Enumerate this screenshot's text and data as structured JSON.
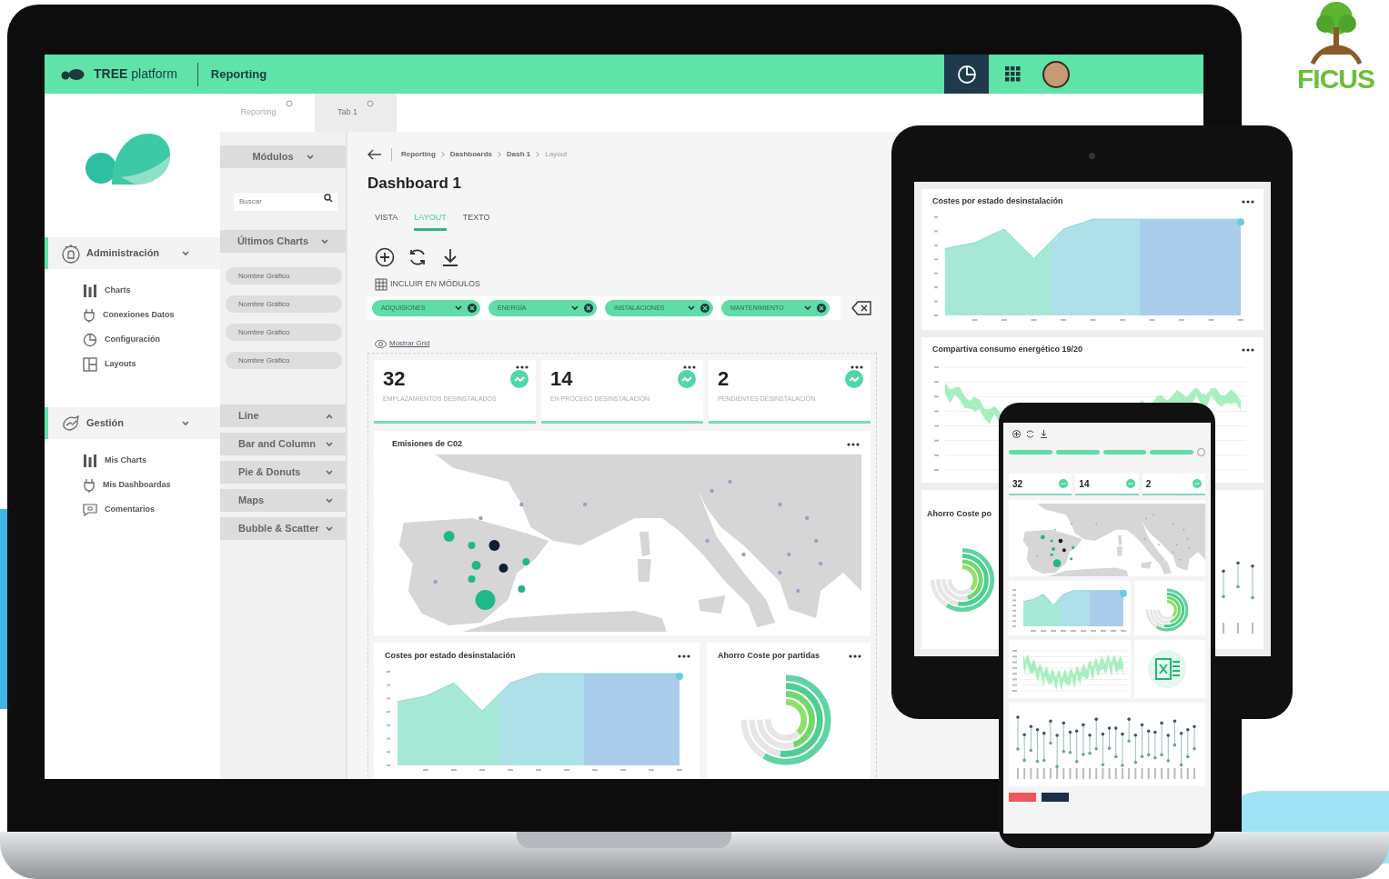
{
  "logo": {
    "text": "FICUS"
  },
  "header": {
    "brand": "**TREE** platform",
    "section": "Reporting"
  },
  "tabs": [
    {
      "label": "Reporting",
      "selected": false
    },
    {
      "label": "Tab 1",
      "selected": true
    }
  ],
  "sidebar": {
    "sections": [
      {
        "label": "Administración",
        "expanded": true,
        "items": [
          "Charts",
          "Conexiones Datos",
          "Configuración",
          "Layouts"
        ]
      },
      {
        "label": "Gestión",
        "expanded": true,
        "items": [
          "Mis Charts",
          "Mis Dashboardas",
          "Comentarios"
        ]
      }
    ]
  },
  "modules": {
    "title": "Módulos",
    "search": {
      "placeholder": "Buscar"
    },
    "recent_title": "Últimos Charts",
    "recent": [
      "Nombre Gráfico",
      "Nombre Gráfico",
      "Nombre Gráfico",
      "Nombre Gráfico"
    ],
    "groups": [
      {
        "label": "Line",
        "expanded": true
      },
      {
        "label": "Bar and Column",
        "expanded": false
      },
      {
        "label": "Pie & Donuts",
        "expanded": false
      },
      {
        "label": "Maps",
        "expanded": false
      },
      {
        "label": "Bubble & Scatter",
        "expanded": false
      }
    ]
  },
  "breadcrumb": [
    {
      "label": "Reporting",
      "current": false
    },
    {
      "label": "Dashboards",
      "current": false
    },
    {
      "label": "Dash 1",
      "current": false
    },
    {
      "label": "Layout",
      "current": true
    }
  ],
  "title": "Dashboard 1",
  "view_tabs": [
    {
      "label": "VISTA",
      "selected": false
    },
    {
      "label": "LAYOUT",
      "selected": true
    },
    {
      "label": "TEXTO",
      "selected": false
    }
  ],
  "include_label": "INCLUIR EN MÓDULOS",
  "chips": [
    "ADQUISIONES",
    "ENERGÍA",
    "INSTALACIONES",
    "MANTENIMIENTO"
  ],
  "grid_link": "Mostrar Grid",
  "kpis": [
    {
      "value": "32",
      "label": "EMPLAZAMIENTOS DESINSTALADOS"
    },
    {
      "value": "14",
      "label": "EN PROCESO DESINSTALACIÓN"
    },
    {
      "value": "2",
      "label": "PENDIENTES DESINSTALACIÓN"
    }
  ],
  "cards": [
    {
      "title": "Emisiones de C02",
      "kind": "map"
    },
    {
      "title": "Costes por estado desinstalación",
      "kind": "area"
    },
    {
      "title": "Ahorro Coste por partidas",
      "kind": "radial"
    }
  ],
  "tablet": {
    "cards": [
      {
        "title": "Costes por estado desinstalación",
        "kind": "area"
      },
      {
        "title": "Compartiva consumo energético 19/20",
        "kind": "line"
      },
      {
        "title": "Ahorro Coste po",
        "kind": "radial"
      }
    ]
  },
  "phone": {
    "kpis": [
      "32",
      "14",
      "2"
    ]
  }
}
